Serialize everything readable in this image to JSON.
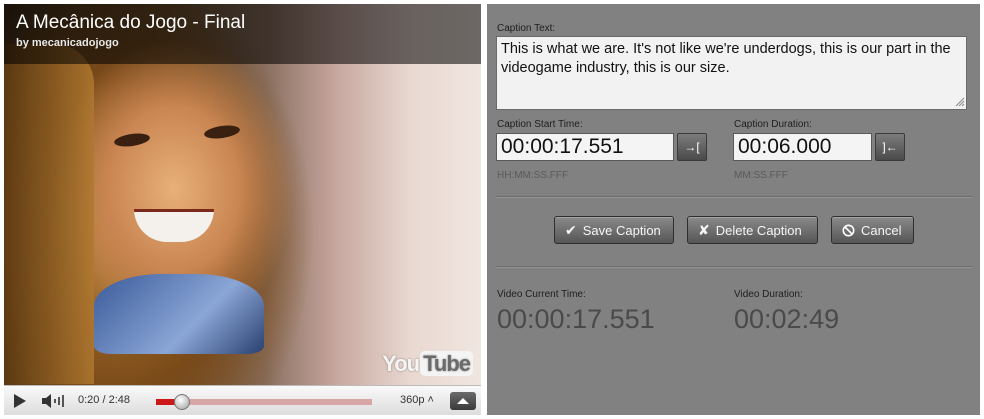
{
  "video": {
    "title": "A Mecânica do Jogo - Final",
    "author": "by mecanicadojogo",
    "logo_you": "You",
    "logo_tube": "Tube",
    "controls": {
      "timecode": "0:20 / 2:48",
      "progress_fraction": 0.12,
      "quality": "360p ˄"
    }
  },
  "editor": {
    "caption_text_label": "Caption Text:",
    "caption_text": "This is what we are. It's not like we're underdogs, this is our part in the videogame industry, this is our size.",
    "start_time_label": "Caption Start Time:",
    "start_time_value": "00:00:17.551",
    "start_time_hint": "HH:MM:SS.FFF",
    "set_start_button": "→[",
    "duration_label": "Caption Duration:",
    "duration_value": "00:06.000",
    "duration_hint": "MM:SS.FFF",
    "set_duration_button": "]←",
    "save_button": "Save Caption",
    "delete_button": "Delete Caption",
    "cancel_button": "Cancel",
    "current_time_label": "Video Current Time:",
    "current_time_value": "00:00:17.551",
    "video_duration_label": "Video Duration:",
    "video_duration_value": "00:02:49"
  },
  "icons": {
    "save": "checkmark-icon",
    "delete": "x-icon",
    "cancel": "no-entry-icon"
  },
  "colors": {
    "panel_bg": "#818181",
    "seek_fill": "#cc1818"
  }
}
